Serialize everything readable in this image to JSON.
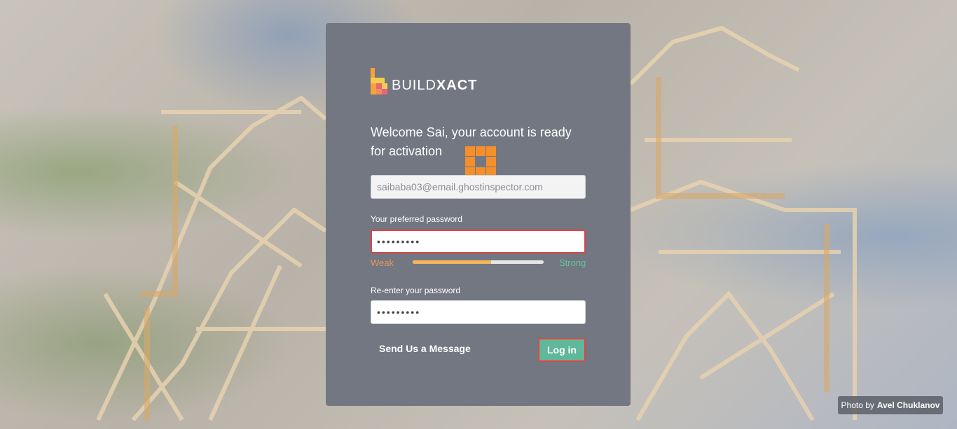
{
  "app": {
    "brand_light": "BUILD",
    "brand_bold": "XACT",
    "brand_colors": {
      "orange": "#f4a43a",
      "pink": "#e8667a",
      "yellow": "#f6cd4a"
    }
  },
  "welcome": {
    "text": "Welcome Sai, your account is ready for activation"
  },
  "form": {
    "email_value": "saibaba03@email.ghostinspector.com",
    "password_label": "Your preferred password",
    "password_value": "•••••••••",
    "strength_weak": "Weak",
    "strength_strong": "Strong",
    "strength_level": 0.6,
    "reenter_label": "Re-enter your password",
    "reenter_value": "•••••••••"
  },
  "actions": {
    "send_message": "Send Us a Message",
    "login": "Log in"
  },
  "credit": {
    "prefix": "Photo by",
    "author": "Avel Chuklanov"
  },
  "colors": {
    "card": "#737781",
    "accent_green": "#5fb89a",
    "error_red": "#e04444",
    "weak": "#e8955c",
    "strong": "#5fc79a"
  }
}
